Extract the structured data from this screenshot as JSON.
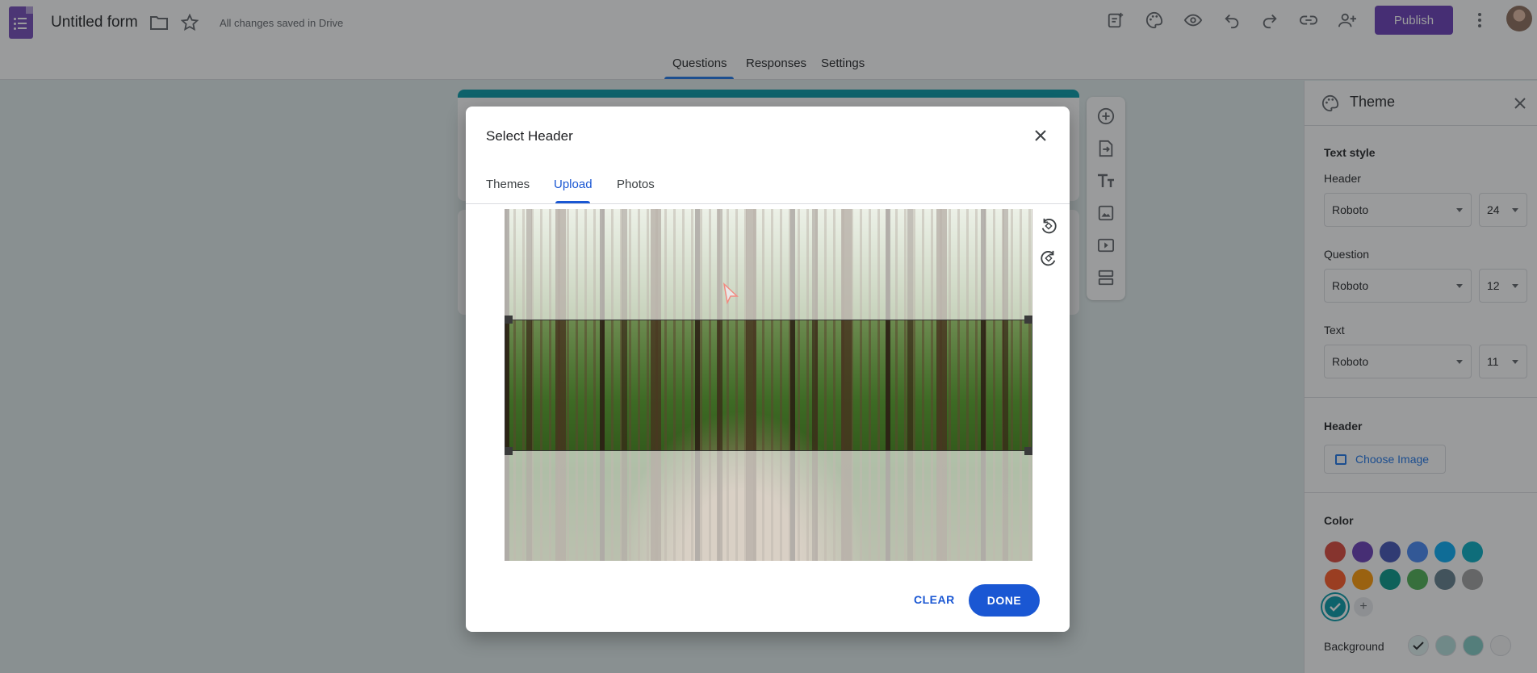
{
  "app": {
    "form_title": "Untitled form",
    "save_status": "All changes saved in Drive",
    "publish_label": "Publish"
  },
  "nav": {
    "tabs": [
      {
        "label": "Questions",
        "active": true
      },
      {
        "label": "Responses",
        "active": false
      },
      {
        "label": "Settings",
        "active": false
      }
    ]
  },
  "theme_panel": {
    "title": "Theme",
    "text_style_label": "Text style",
    "header_label": "Header",
    "header_font": "Roboto",
    "header_size": "24",
    "question_label": "Question",
    "question_font": "Roboto",
    "question_size": "12",
    "text_label": "Text",
    "text_font": "Roboto",
    "text_size": "11",
    "header_section_label": "Header",
    "choose_image_label": "Choose Image",
    "color_label": "Color",
    "colors": [
      "#db4437",
      "#673ab7",
      "#3f51b5",
      "#4285f4",
      "#03a9f4",
      "#00acc1",
      "#ff5722",
      "#ff9800",
      "#009688",
      "#4caf50",
      "#607d8b",
      "#9e9e9e",
      "#0097a7"
    ],
    "selected_color": "#0097a7",
    "background_label": "Background",
    "background_colors": [
      "#e0f2f1",
      "#b2dfdb",
      "#80cbc4",
      "#f6f6f6"
    ]
  },
  "dialog": {
    "title": "Select Header",
    "tabs": [
      {
        "label": "Themes",
        "active": false
      },
      {
        "label": "Upload",
        "active": true
      },
      {
        "label": "Photos",
        "active": false
      }
    ],
    "clear_label": "CLEAR",
    "done_label": "DONE"
  }
}
